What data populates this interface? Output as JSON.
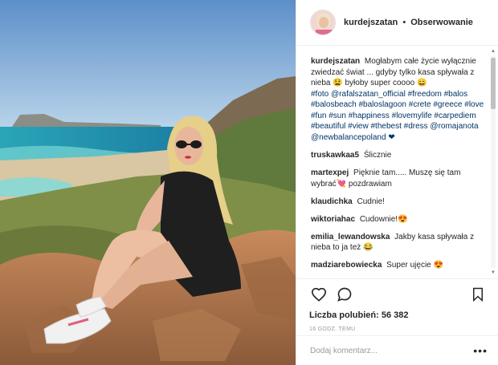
{
  "header": {
    "username": "kurdejszatan",
    "separator": "•",
    "follow_label": "Obserwowanie"
  },
  "caption": {
    "username": "kurdejszatan",
    "text": "Mogłabym całe życie wyłącznie zwiedzać świat ... gdyby tylko kasa spływała z nieba 😫 byłoby super coooo 😄",
    "tags": "#foto @rafalszatan_official #freedom #balos #balosbeach #baloslagoon #crete #greece #love #fun #sun #happiness #lovemylife #carpediem #beautiful #view #thebest #dress @romajanota @newbalancepoland ❤"
  },
  "comments": [
    {
      "user": "truskawkaa5",
      "text": "Ślicznie"
    },
    {
      "user": "martexpej",
      "text": "Pięknie tam..... Muszę się tam wybrać💘 pozdrawiam"
    },
    {
      "user": "klaudichka",
      "text": "Cudnie!"
    },
    {
      "user": "wiktoriahac",
      "text": "Cudownie!😍"
    },
    {
      "user": "emilia_lewandowska",
      "text": "Jakby kasa spływała z nieba to ja też 😂"
    },
    {
      "user": "madziarebowiecka",
      "text": "Super ujęcie 😍"
    }
  ],
  "actions": {
    "icons": [
      "heart-icon",
      "comment-icon",
      "bookmark-icon"
    ]
  },
  "likes": {
    "label": "Liczba polubień:",
    "count": "56 382"
  },
  "timestamp": "16 GODZ. TEMU",
  "add_comment": {
    "placeholder": "Dodaj komentarz...",
    "more_label": "•••"
  },
  "colors": {
    "hashtag": "#003569",
    "text": "#262626",
    "muted": "#999999",
    "border": "#efefef"
  }
}
